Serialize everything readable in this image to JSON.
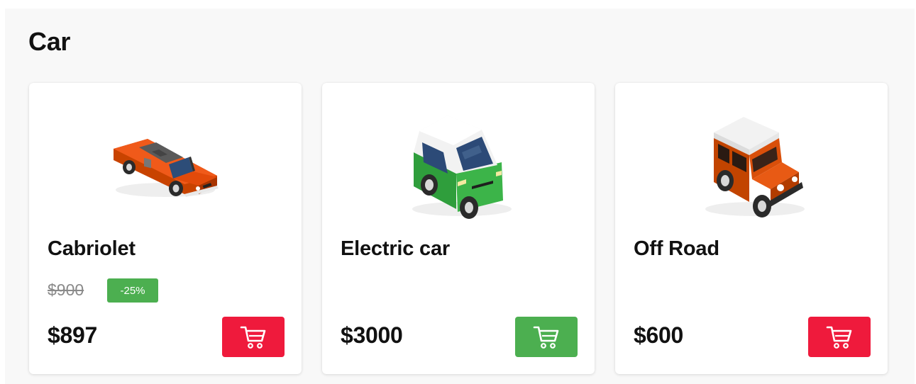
{
  "section": {
    "title": "Car"
  },
  "colors": {
    "cart_red": "#ef1a3c",
    "cart_green": "#4caf50",
    "badge_green": "#4caf50"
  },
  "products": [
    {
      "name": "Cabriolet",
      "old_price": "$900",
      "discount": "-25%",
      "price": "$897",
      "image_icon": "cabriolet-car-icon",
      "cart_icon": "shopping-cart-icon",
      "cart_button_color": "#ef1a3c"
    },
    {
      "name": "Electric car",
      "price": "$3000",
      "image_icon": "electric-car-icon",
      "cart_icon": "shopping-cart-icon",
      "cart_button_color": "#4caf50"
    },
    {
      "name": "Off Road",
      "price": "$600",
      "image_icon": "off-road-car-icon",
      "cart_icon": "shopping-cart-icon",
      "cart_button_color": "#ef1a3c"
    }
  ]
}
